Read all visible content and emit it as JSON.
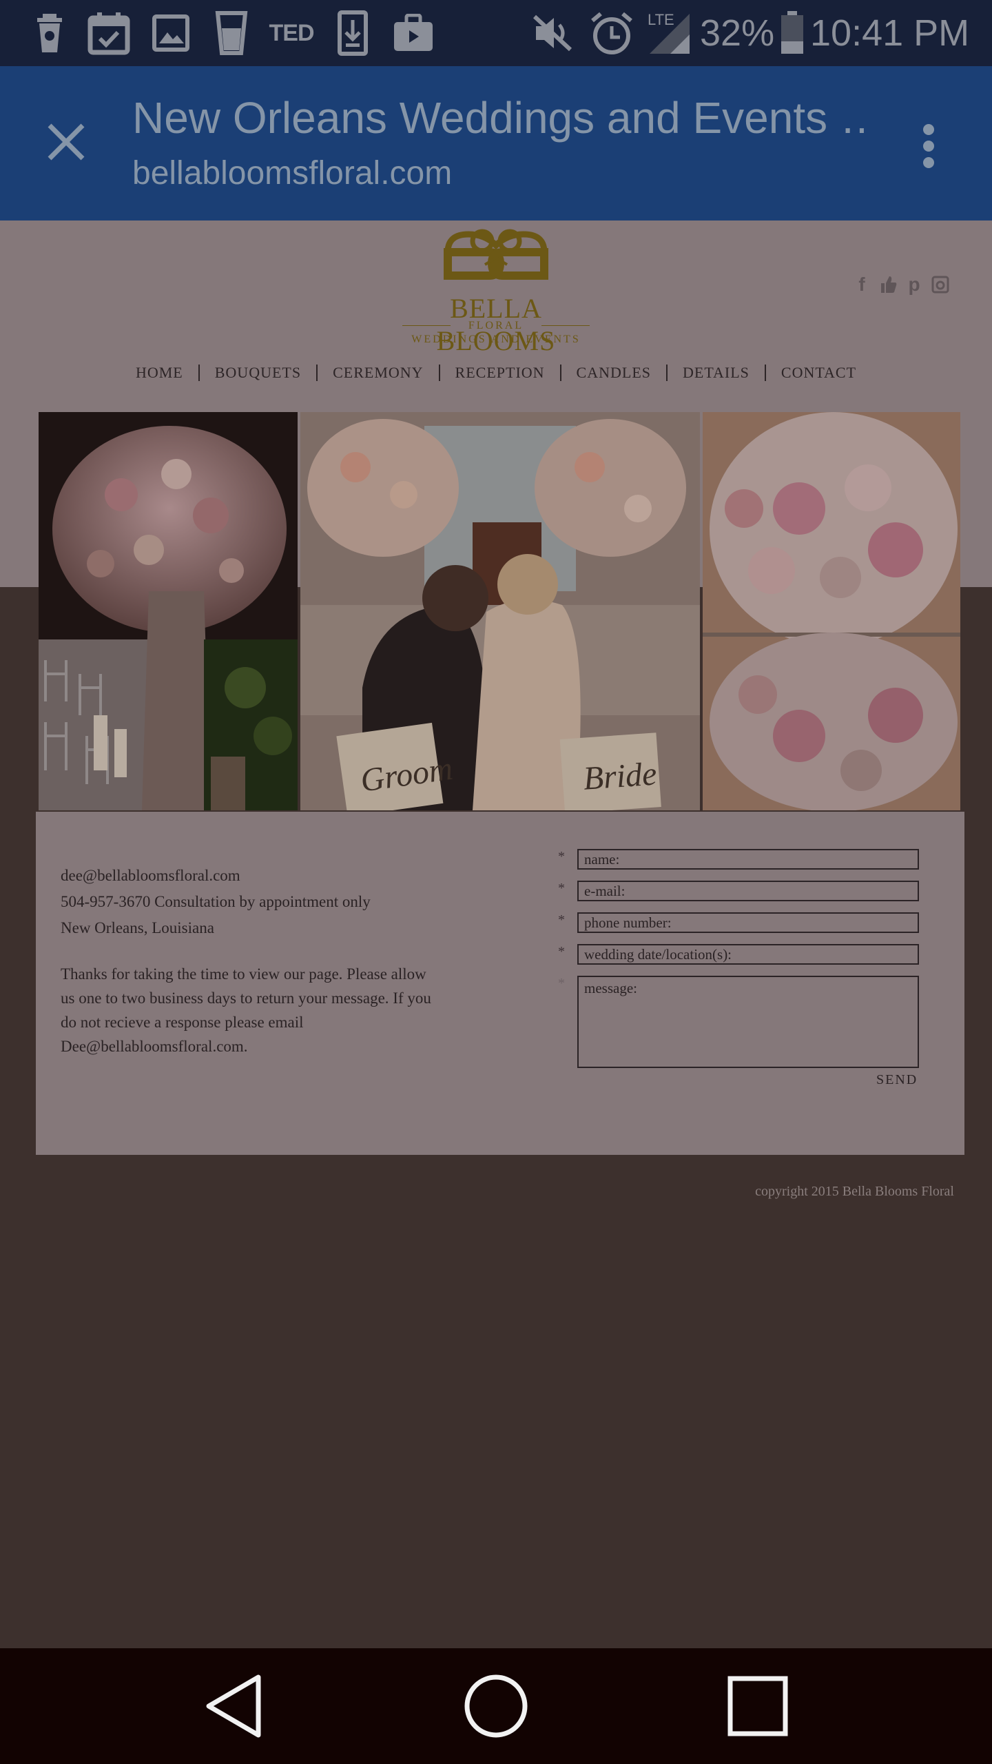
{
  "status_bar": {
    "notification_icons": [
      "coffee-cup-icon",
      "calendar-check-icon",
      "image-icon",
      "glass-icon",
      "ted-icon",
      "download-icon",
      "briefcase-icon"
    ],
    "ted_label": "TED",
    "network_label": "LTE",
    "battery": "32%",
    "time": "10:41 PM"
  },
  "app_bar": {
    "title": "New Orleans Weddings and Events …",
    "url": "bellabloomsfloral.com"
  },
  "site": {
    "brand_name": "BELLA BLOOMS",
    "brand_sub1": "FLORAL",
    "brand_sub2": "WEDDINGS AND EVENTS",
    "social_icons": [
      "facebook-icon",
      "like-icon",
      "pinterest-icon",
      "instagram-icon"
    ],
    "nav": [
      "HOME",
      "BOUQUETS",
      "CEREMONY",
      "RECEPTION",
      "CANDLES",
      "DETAILS",
      "CONTACT"
    ],
    "hero_signs": [
      "Groom",
      "Bride"
    ],
    "contact": {
      "email": "dee@bellabloomsfloral.com",
      "phone": "504-957-3670 Consultation by appointment only",
      "location": "New Orleans, Louisiana",
      "message": "Thanks for taking the time to view our page. Please allow us one to two business days to return your message. If you do not recieve a response please email Dee@bellabloomsfloral.com."
    },
    "form": {
      "name_placeholder": "name:",
      "email_placeholder": "e-mail:",
      "phone_placeholder": "phone number:",
      "date_placeholder": "wedding date/location(s):",
      "message_placeholder": "message:",
      "required_mark": "*",
      "send_label": "SEND"
    },
    "copyright": "copyright 2015 Bella Blooms Floral"
  },
  "colors": {
    "status_bar": "#172038",
    "app_bar": "#1b3f75",
    "page_background": "#85787a",
    "outer_background": "#3d302d",
    "logo_gold": "#6c5815",
    "nav_bar": "#120302"
  }
}
